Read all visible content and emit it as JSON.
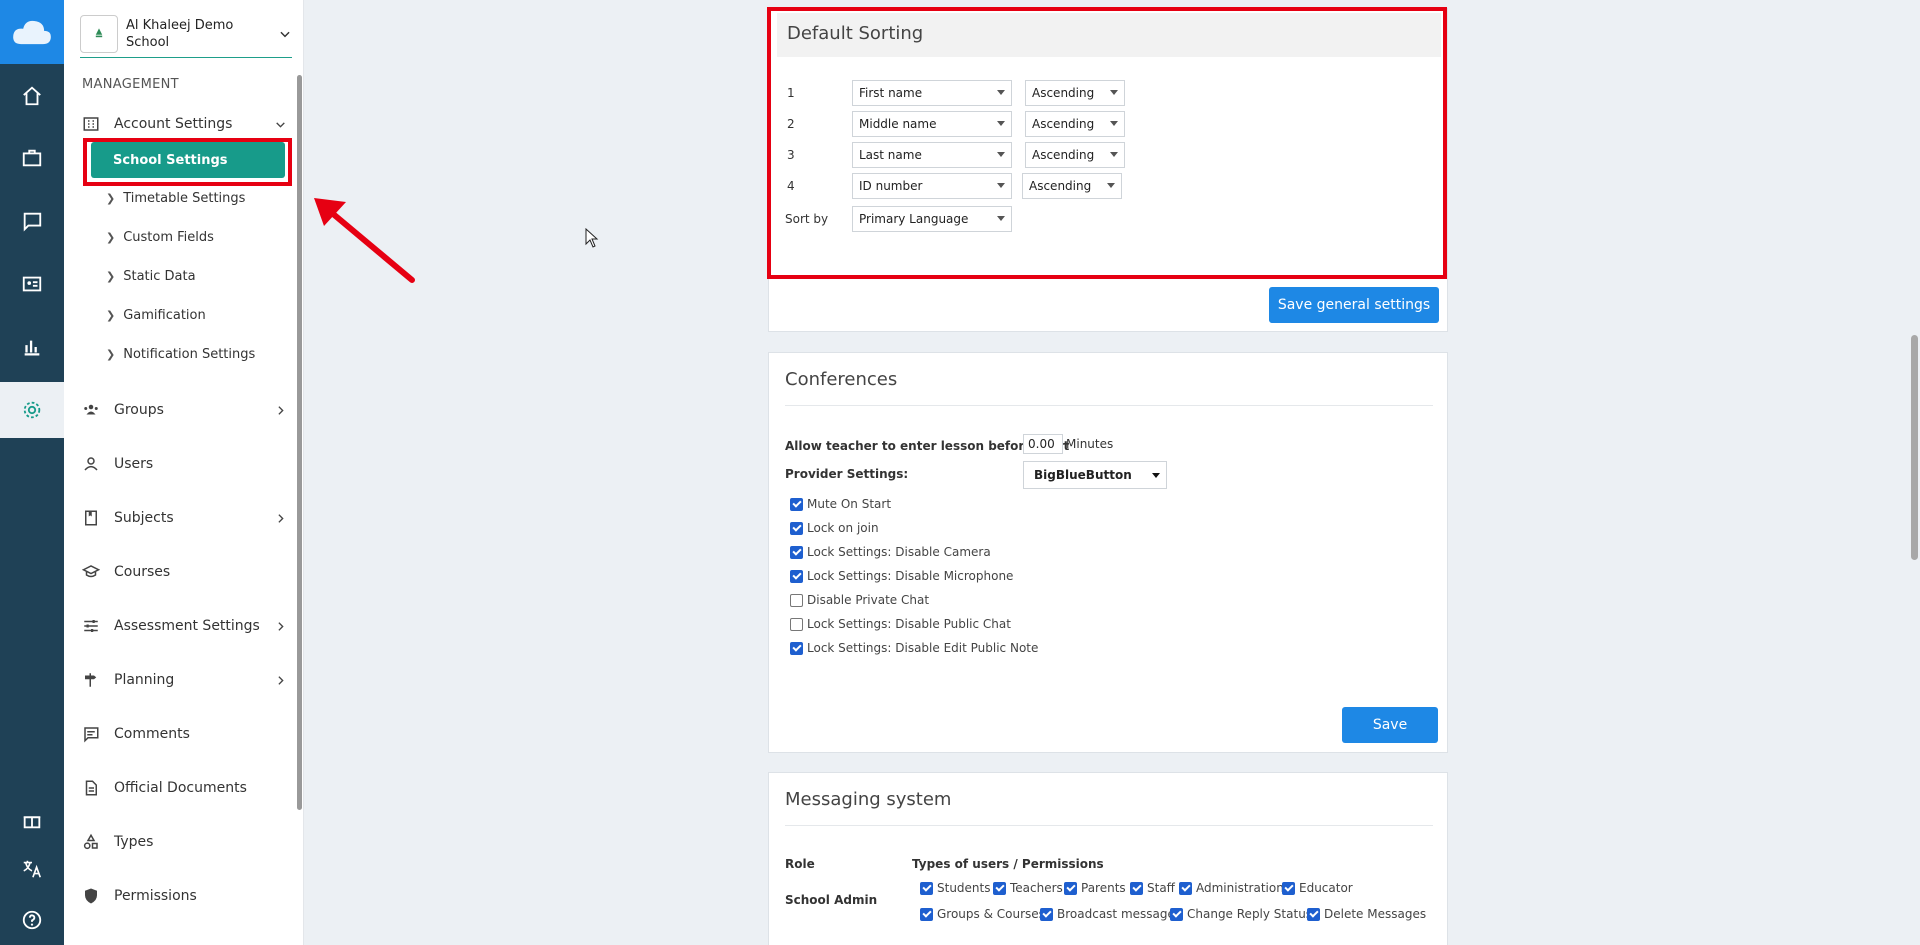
{
  "school": {
    "name": "Al Khaleej Demo School"
  },
  "sidebar": {
    "section_label": "MANAGEMENT",
    "account_settings": "Account Settings",
    "school_settings": "School Settings",
    "sub_items": [
      "Timetable Settings",
      "Custom Fields",
      "Static Data",
      "Gamification",
      "Notification Settings"
    ],
    "items": [
      "Groups",
      "Users",
      "Subjects",
      "Courses",
      "Assessment Settings",
      "Planning",
      "Comments",
      "Official Documents",
      "Types",
      "Permissions"
    ]
  },
  "default_sorting": {
    "title": "Default Sorting",
    "rows": [
      {
        "num": "1",
        "field": "First name",
        "order": "Ascending"
      },
      {
        "num": "2",
        "field": "Middle name",
        "order": "Ascending"
      },
      {
        "num": "3",
        "field": "Last name",
        "order": "Ascending"
      },
      {
        "num": "4",
        "field": "ID number",
        "order": "Ascending"
      }
    ],
    "sort_by_label": "Sort by",
    "sort_by_value": "Primary Language",
    "save_label": "Save general settings"
  },
  "conferences": {
    "title": "Conferences",
    "allow_label": "Allow teacher to enter lesson before start",
    "allow_value": "0.00",
    "allow_unit": "Minutes",
    "provider_label": "Provider Settings:",
    "provider_value": "BigBlueButton",
    "options": [
      {
        "label": "Mute On Start",
        "checked": true
      },
      {
        "label": "Lock on join",
        "checked": true
      },
      {
        "label": "Lock Settings: Disable Camera",
        "checked": true
      },
      {
        "label": "Lock Settings: Disable Microphone",
        "checked": true
      },
      {
        "label": "Disable Private Chat",
        "checked": false
      },
      {
        "label": "Lock Settings: Disable Public Chat",
        "checked": false
      },
      {
        "label": "Lock Settings: Disable Edit Public Note",
        "checked": true
      }
    ],
    "save_label": "Save"
  },
  "messaging": {
    "title": "Messaging system",
    "role_header": "Role",
    "types_header": "Types of users / Permissions",
    "role": "School Admin",
    "perms_row1": [
      "Students",
      "Teachers",
      "Parents",
      "Staff",
      "Administration",
      "Educator"
    ],
    "perms_row2": [
      "Groups & Courses",
      "Broadcast message",
      "Change Reply Status",
      "Delete Messages"
    ]
  },
  "colors": {
    "rail": "#1f4156",
    "accent": "#179b8a",
    "primary": "#1e88e5",
    "highlight": "#e60012"
  }
}
